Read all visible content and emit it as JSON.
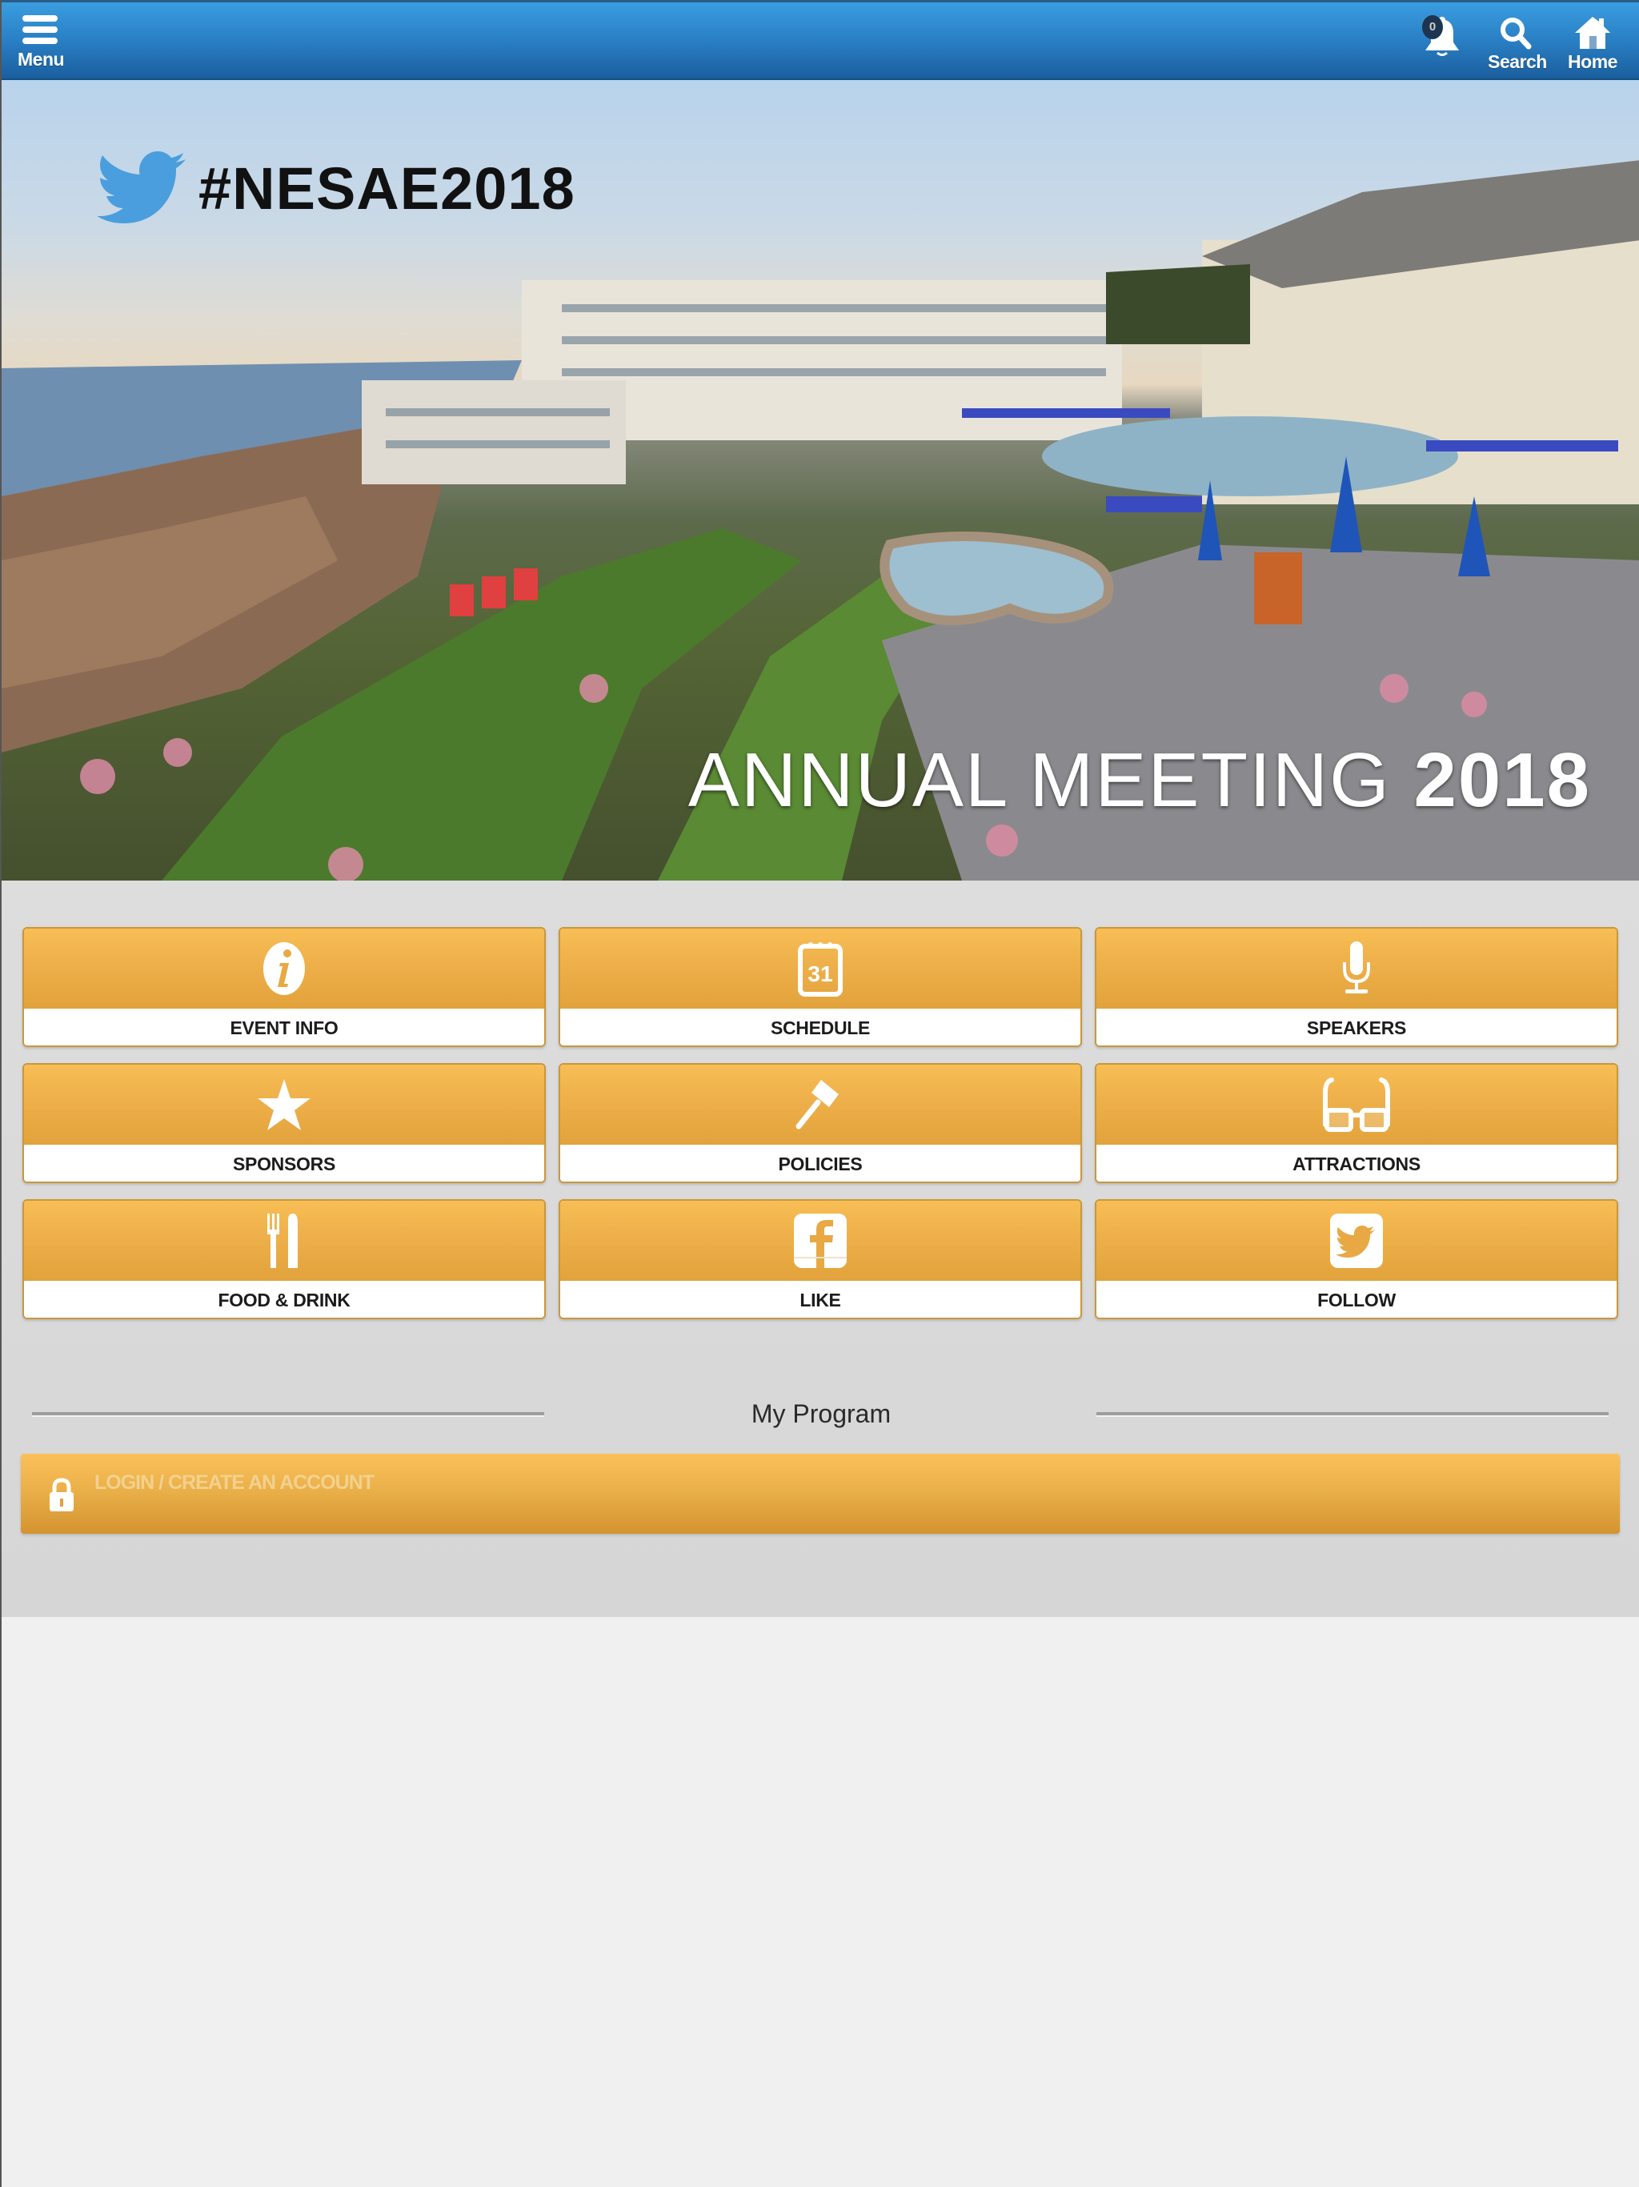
{
  "topbar": {
    "menu_label": "Menu",
    "notifications_count": "0",
    "search_label": "Search",
    "home_label": "Home",
    "bar_color": "#2a7fc4"
  },
  "hero": {
    "hashtag": "#NESAE2018",
    "title_light": "ANNUAL MEETING",
    "title_bold": "2018",
    "twitter_color": "#4a9ede"
  },
  "tiles": [
    {
      "label": "EVENT INFO",
      "icon": "info-icon"
    },
    {
      "label": "SCHEDULE",
      "icon": "calendar-icon",
      "icon_text": "31"
    },
    {
      "label": "SPEAKERS",
      "icon": "microphone-icon"
    },
    {
      "label": "SPONSORS",
      "icon": "star-icon"
    },
    {
      "label": "POLICIES",
      "icon": "gavel-icon"
    },
    {
      "label": "ATTRACTIONS",
      "icon": "glasses-icon"
    },
    {
      "label": "FOOD & DRINK",
      "icon": "fork-knife-icon"
    },
    {
      "label": "LIKE",
      "icon": "facebook-icon"
    },
    {
      "label": "FOLLOW",
      "icon": "twitter-icon"
    }
  ],
  "my_program": {
    "title": "My Program",
    "login_label": "LOGIN / CREATE AN ACCOUNT"
  },
  "colors": {
    "tile_gold": "#efb14b",
    "tile_border": "#c9983c",
    "background": "#d9d9d9"
  }
}
